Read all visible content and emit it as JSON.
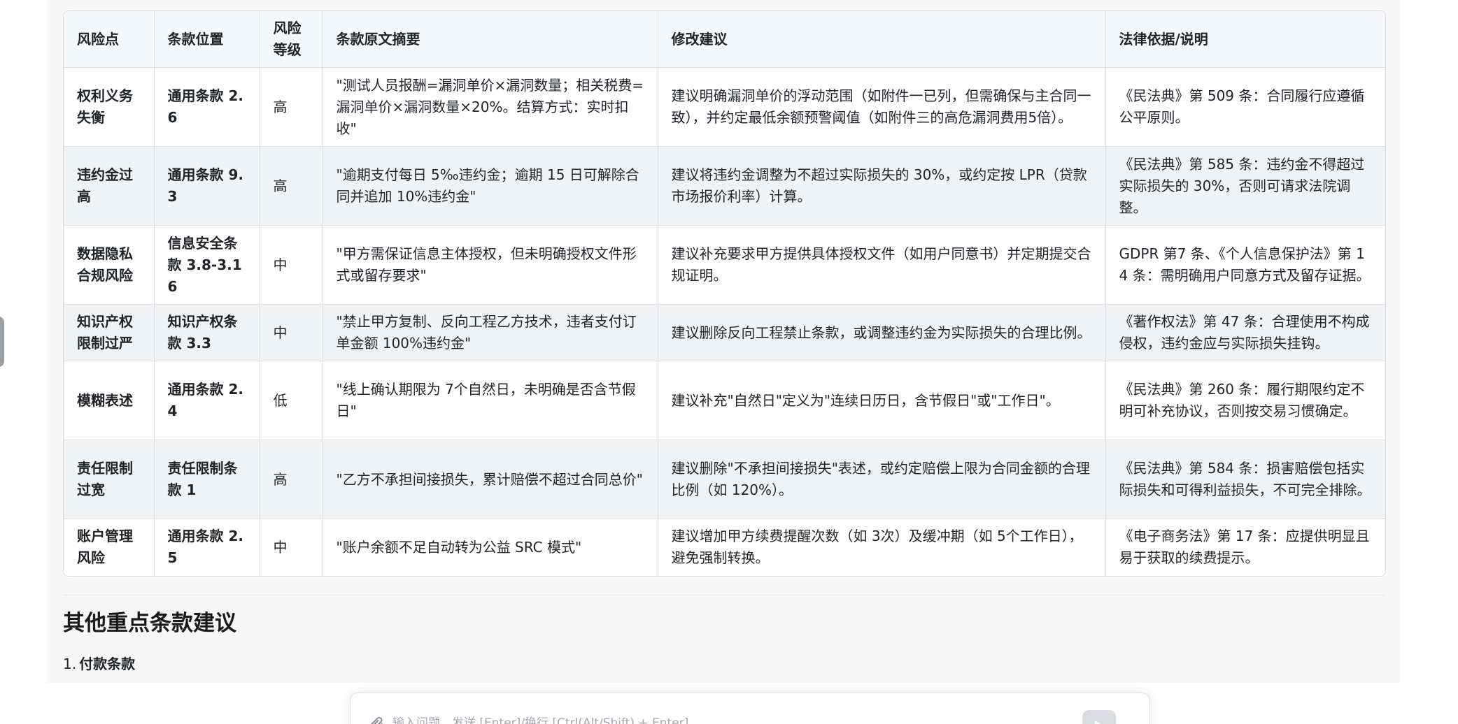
{
  "risk_table": {
    "headers": [
      "风险点",
      "条款位置",
      "风险等级",
      "条款原文摘要",
      "修改建议",
      "法律依据/说明"
    ],
    "rows": [
      {
        "risk": "权利义务失衡",
        "position": "通用条款 2.6",
        "level": "高",
        "excerpt": "\"测试人员报酬=漏洞单价×漏洞数量；相关税费=漏洞单价×漏洞数量×20%。结算方式：实时扣收\"",
        "suggestion": "建议明确漏洞单价的浮动范围（如附件一已列，但需确保与主合同一致），并约定最低余额预警阈值（如附件三的高危漏洞费用5倍）。",
        "basis": "《民法典》第 509 条：合同履行应遵循公平原则。"
      },
      {
        "risk": "违约金过高",
        "position": "通用条款 9.3",
        "level": "高",
        "excerpt": "\"逾期支付每日 5‰违约金；逾期 15 日可解除合同并追加 10%违约金\"",
        "suggestion": "建议将违约金调整为不超过实际损失的 30%，或约定按 LPR（贷款市场报价利率）计算。",
        "basis": "《民法典》第 585 条：违约金不得超过实际损失的 30%，否则可请求法院调整。"
      },
      {
        "risk": "数据隐私合规风险",
        "position": "信息安全条款 3.8-3.16",
        "level": "中",
        "excerpt": "\"甲方需保证信息主体授权，但未明确授权文件形式或留存要求\"",
        "suggestion": "建议补充要求甲方提供具体授权文件（如用户同意书）并定期提交合规证明。",
        "basis": "GDPR 第7 条、《个人信息保护法》第 14 条：需明确用户同意方式及留存证据。"
      },
      {
        "risk": "知识产权限制过严",
        "position": "知识产权条款 3.3",
        "level": "中",
        "excerpt": "\"禁止甲方复制、反向工程乙方技术，违者支付订单金额 100%违约金\"",
        "suggestion": "建议删除反向工程禁止条款，或调整违约金为实际损失的合理比例。",
        "basis": "《著作权法》第 47 条：合理使用不构成侵权，违约金应与实际损失挂钩。"
      },
      {
        "risk": "模糊表述",
        "position": "通用条款 2.4",
        "level": "低",
        "excerpt": "\"线上确认期限为 7个自然日，未明确是否含节假日\"",
        "suggestion": "建议补充\"自然日\"定义为\"连续日历日，含节假日\"或\"工作日\"。",
        "basis": "《民法典》第 260 条：履行期限约定不明可补充协议，否则按交易习惯确定。"
      },
      {
        "risk": "责任限制过宽",
        "position": "责任限制条款 1",
        "level": "高",
        "excerpt": "\"乙方不承担间接损失，累计赔偿不超过合同总价\"",
        "suggestion": "建议删除\"不承担间接损失\"表述，或约定赔偿上限为合同金额的合理比例（如 120%）。",
        "basis": "《民法典》第 584 条：损害赔偿包括实际损失和可得利益损失，不可完全排除。"
      },
      {
        "risk": "账户管理风险",
        "position": "通用条款 2.5",
        "level": "中",
        "excerpt": "\"账户余额不足自动转为公益 SRC 模式\"",
        "suggestion": "建议增加甲方续费提醒次数（如 3次）及缓冲期（如 5个工作日），避免强制转换。",
        "basis": "《电子商务法》第 17 条：应提供明显且易于获取的续费提示。"
      }
    ]
  },
  "section": {
    "title": "其他重点条款建议",
    "list_number": "1.",
    "list_label": "付款条款"
  },
  "input": {
    "placeholder": "输入问题，发送 [Enter]/换行 [Ctrl(Alt/Shift) + Enter]"
  },
  "icons": {
    "attach": "paperclip-icon",
    "send": "send-icon"
  }
}
